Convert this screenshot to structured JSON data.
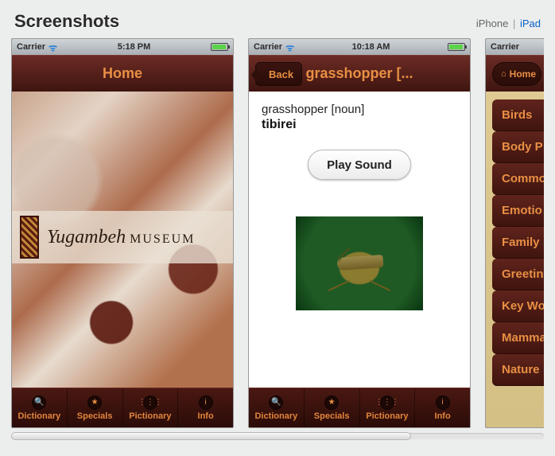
{
  "section_title": "Screenshots",
  "device_tabs": {
    "iphone": "iPhone",
    "ipad": "iPad"
  },
  "statusbar": {
    "carrier": "Carrier"
  },
  "tabbar": {
    "items": [
      {
        "icon": "🔍",
        "label": "Dictionary"
      },
      {
        "icon": "★",
        "label": "Specials"
      },
      {
        "icon": "⋮⋮⋮",
        "label": "Pictionary"
      },
      {
        "icon": "i",
        "label": "Info"
      }
    ]
  },
  "screen1": {
    "time": "5:18 PM",
    "nav_title": "Home",
    "museum_name_script": "Yugambeh",
    "museum_name_caps": "MUSEUM"
  },
  "screen2": {
    "time": "10:18 AM",
    "back_label": "Back",
    "nav_title": "grasshopper [...",
    "entry_headword": "grasshopper [noun]",
    "entry_native": "tibirei",
    "play_label": "Play Sound"
  },
  "screen3": {
    "home_label": "Home",
    "categories": [
      "Birds",
      "Body P",
      "Commo",
      "Emotio",
      "Family",
      "Greetin",
      "Key Wo",
      "Mamma",
      "Nature"
    ]
  }
}
